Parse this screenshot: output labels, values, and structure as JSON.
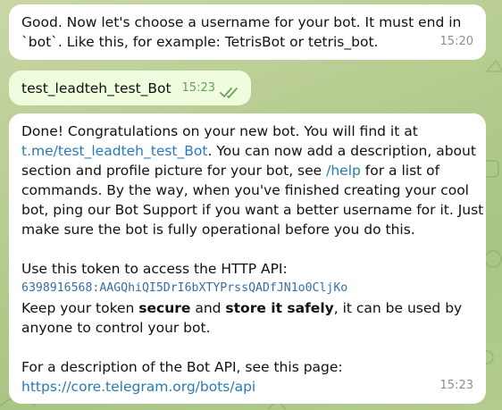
{
  "messages": {
    "m1": {
      "line1": "Good. Now let's choose a username for your bot. It must end in",
      "line2": "`bot`. Like this, for example: TetrisBot or tetris_bot.",
      "time": "15:20"
    },
    "m2": {
      "text": "test_leadteh_test_Bot",
      "time": "15:23"
    },
    "m3": {
      "p1_l1": "Done! Congratulations on your new bot. You will find it at",
      "p1_link": "t.me/test_leadteh_test_Bot",
      "p1_l2_rest": ". You can now add a description, about",
      "p1_l3": "section and profile picture for your bot, see ",
      "p1_help": "/help",
      "p1_l3_rest": " for a list of",
      "p1_l4": "commands. By the way, when you've finished creating your cool",
      "p1_l5": "bot, ping our Bot Support if you want a better username for it. Just",
      "p1_l6": "make sure the bot is fully operational before you do this.",
      "p2_l1": "Use this token to access the HTTP API:",
      "token": "6398916568:AAGQhiQI5DrI6bXTYPrssQADfJN1o0CljKo",
      "p2_l3a": "Keep your token ",
      "p2_secure": "secure",
      "p2_l3b": " and ",
      "p2_store": "store it safely",
      "p2_l3c": ", it can be used by",
      "p2_l4": "anyone to control your bot.",
      "p3_l1": "For a description of the Bot API, see this page:",
      "p3_link": "https://core.telegram.org/bots/api",
      "time": "15:23"
    }
  },
  "icons": {
    "read_checks": "double-check-icon"
  },
  "colors": {
    "link": "#2a7ab8",
    "token": "#3a6ea3",
    "outgoing_bubble": "#effdde",
    "read_check": "#6aa05a"
  }
}
